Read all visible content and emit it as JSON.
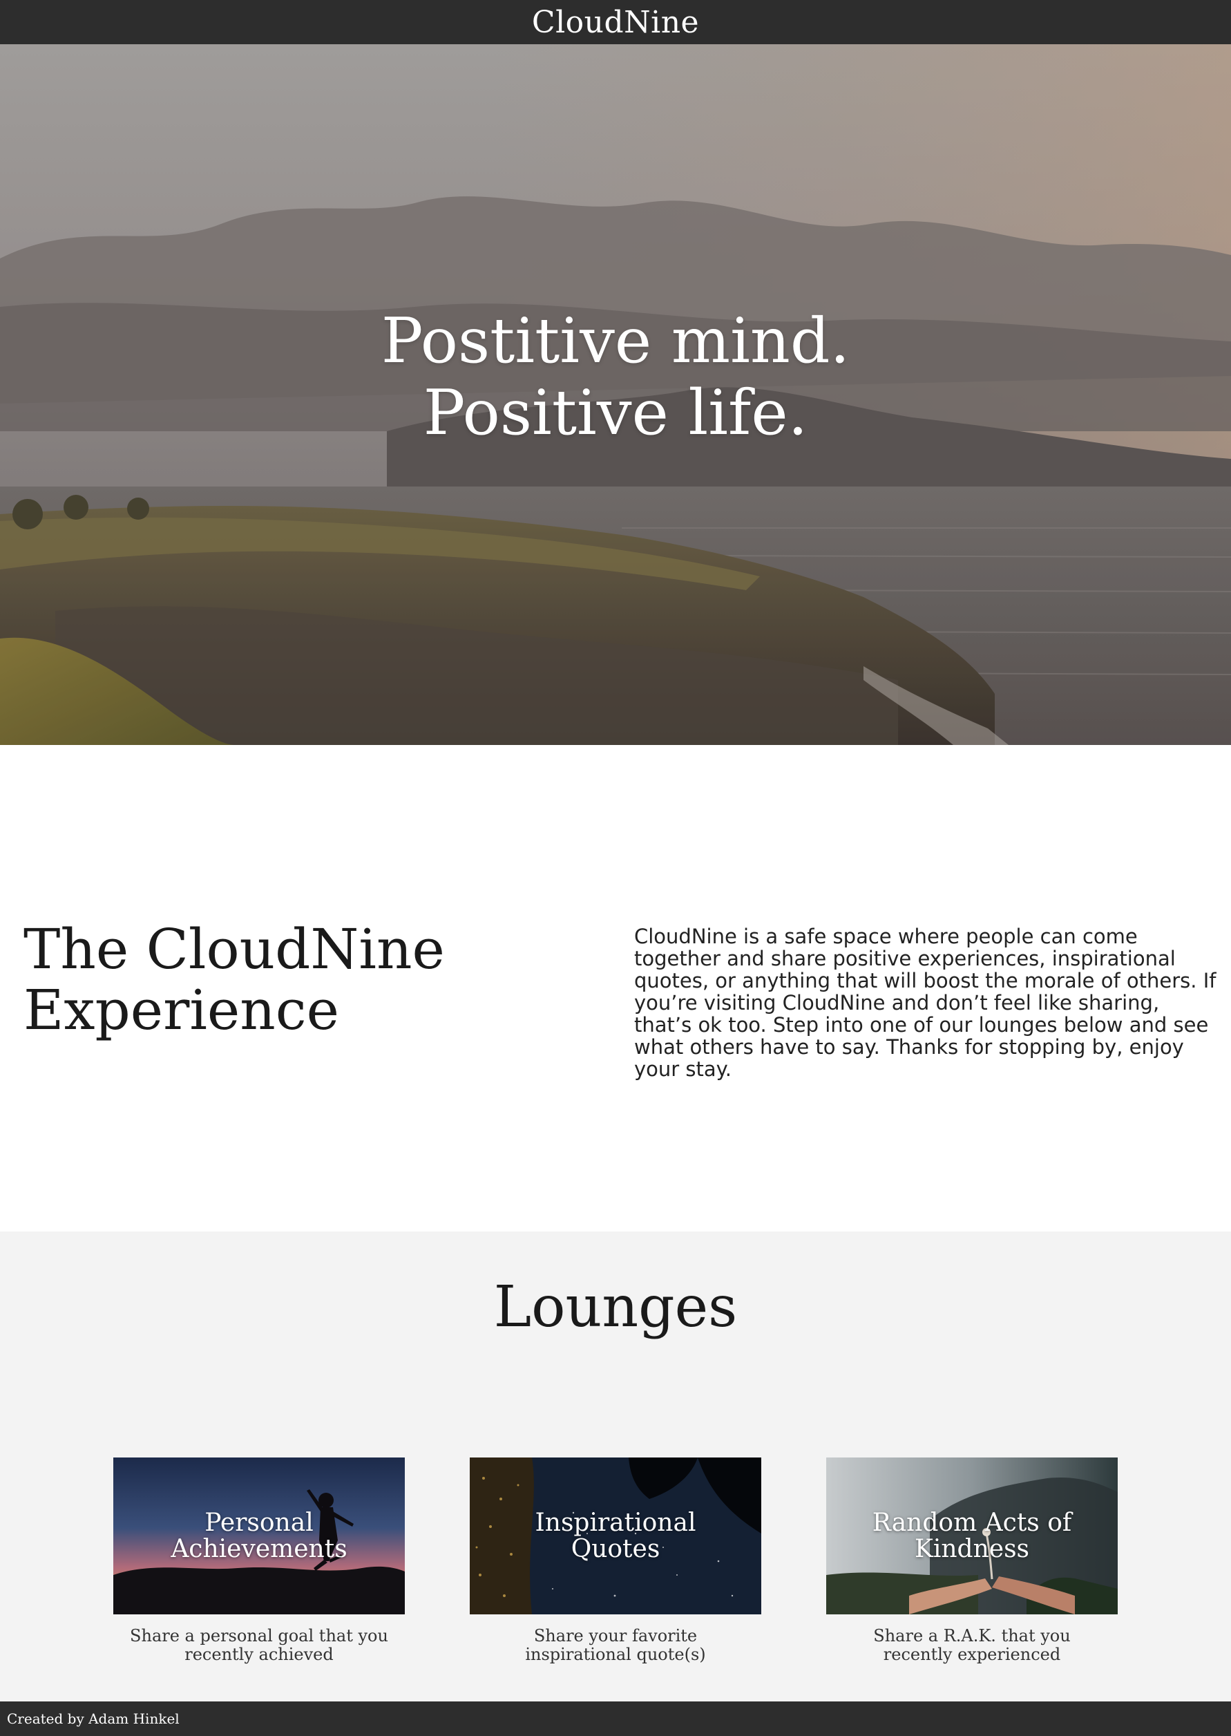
{
  "header": {
    "brand": "CloudNine"
  },
  "hero": {
    "line1": "Postitive mind.",
    "line2": "Positive life."
  },
  "about": {
    "title_line1": "The CloudNine",
    "title_line2": "Experience",
    "text": "CloudNine is a safe space where people can come together and share positive experiences, inspirational quotes, or anything that will boost the morale of others. If you’re visiting CloudNine and don’t feel like sharing, that’s ok too. Step into one of our lounges below and see what others have to say. Thanks for stopping by, enjoy your stay."
  },
  "lounges": {
    "title": "Lounges",
    "cards": [
      {
        "label": "Personal Achievements",
        "description": "Share a personal goal that you recently achieved"
      },
      {
        "label": "Inspirational Quotes",
        "description": "Share your favorite inspirational quote(s)"
      },
      {
        "label": "Random Acts of Kindness",
        "description": "Share a R.A.K. that you recently experienced"
      }
    ]
  },
  "footer": {
    "credit": "Created by Adam Hinkel"
  },
  "colors": {
    "bar": "#2d2d2d",
    "lounges_bg": "#f3f3f3"
  }
}
